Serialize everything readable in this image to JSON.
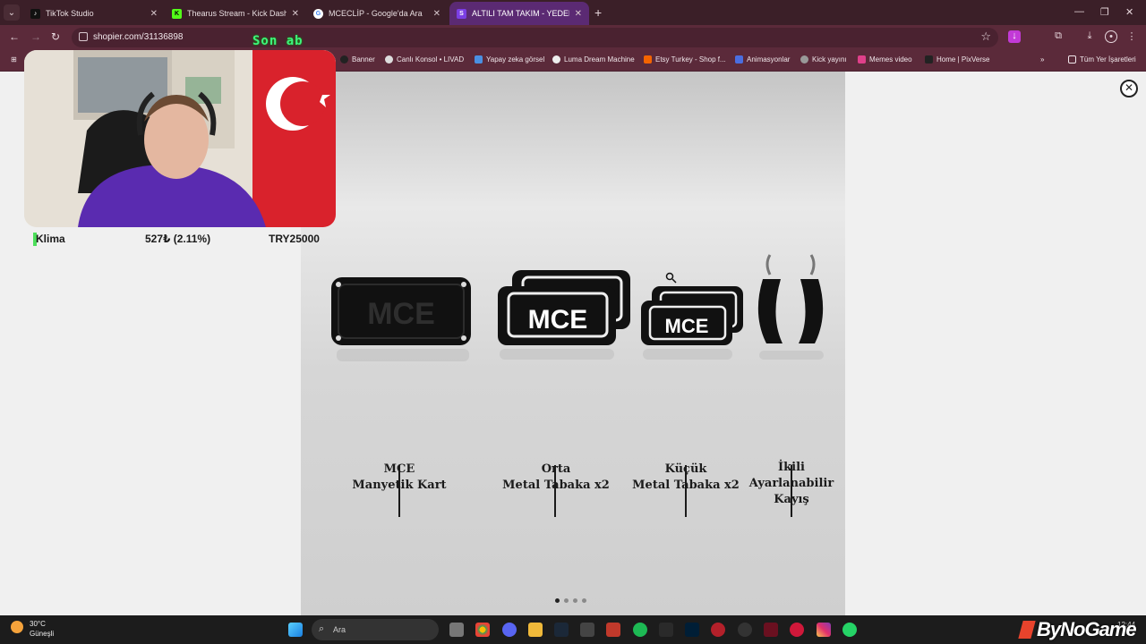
{
  "browser": {
    "tabs": [
      {
        "title": "TikTok Studio",
        "icon": "tiktok-icon"
      },
      {
        "title": "Thearus Stream - Kick Dashboard",
        "icon": "kick-icon"
      },
      {
        "title": "MCECLİP - Google'da Ara",
        "icon": "google-icon"
      },
      {
        "title": "ALTILI TAM TAKIM - YEDEK ME",
        "icon": "shopier-icon"
      }
    ],
    "url": "shopier.com/31136898",
    "bookmarks": [
      {
        "label": "Banner"
      },
      {
        "label": "Canlı Konsol • LIVAD"
      },
      {
        "label": "Yapay zeka görsel"
      },
      {
        "label": "Luma Dream Machine"
      },
      {
        "label": "Etsy Turkey - Shop f..."
      },
      {
        "label": "Animasyonlar"
      },
      {
        "label": "Kick yayını"
      },
      {
        "label": "Memes video"
      },
      {
        "label": "Home | PixVerse"
      }
    ],
    "all_bookmarks": "Tüm Yer İşaretleri"
  },
  "overlay": {
    "stream_text": "Son ab",
    "ticker": {
      "name": "Klima",
      "change": "527₺ (2.11%)",
      "price": "TRY25000"
    }
  },
  "product": {
    "items": [
      {
        "line1": "MCE",
        "line2": "Manyetik Kart",
        "line3": ""
      },
      {
        "line1": "Orta",
        "line2": "Metal Tabaka x2",
        "line3": ""
      },
      {
        "line1": "Küçük",
        "line2": "Metal Tabaka x2",
        "line3": ""
      },
      {
        "line1": "İkili",
        "line2": "Ayarlanabilir",
        "line3": "Kayış"
      }
    ],
    "logo_text": "MCE",
    "carousel_count": 4,
    "carousel_active": 0
  },
  "taskbar": {
    "temp": "30°C",
    "condition": "Güneşli",
    "search_placeholder": "Ara",
    "time": "12:44"
  },
  "watermark": "ByNoGame"
}
